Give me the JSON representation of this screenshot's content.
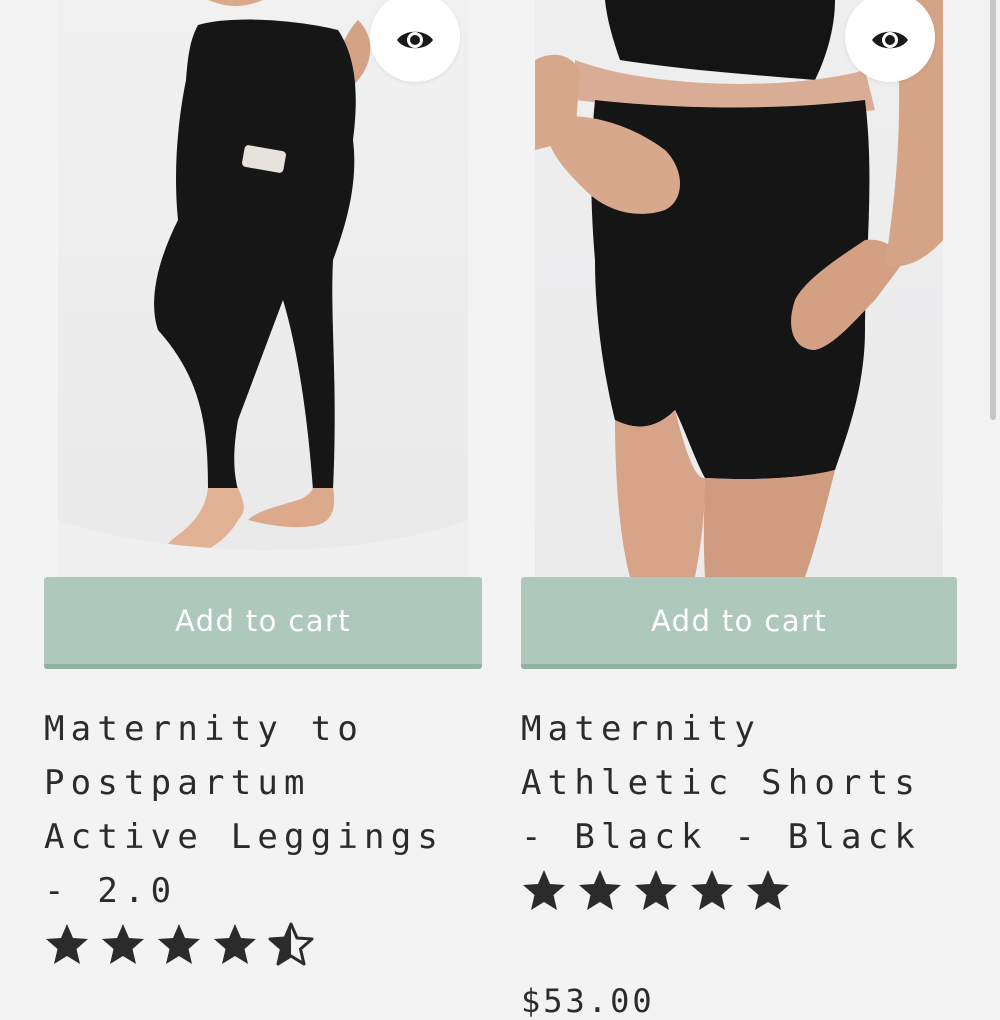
{
  "products": [
    {
      "title": "Maternity to Postpartum Active Leggings - 2.0",
      "add_to_cart": "Add to cart",
      "rating": 4.5,
      "rating_max": 5
    },
    {
      "title": "Maternity Athletic Shorts - Black - Black",
      "add_to_cart": "Add to cart",
      "rating": 5,
      "rating_max": 5,
      "price": "$53.00"
    }
  ],
  "colors": {
    "page_bg": "#f3f3f3",
    "add_to_cart_bg": "#aec9bc",
    "text": "#2b2b2b",
    "star": "#2b2b2b"
  },
  "icons": {
    "quick_view": "eye-icon",
    "rating": "star-icon"
  }
}
